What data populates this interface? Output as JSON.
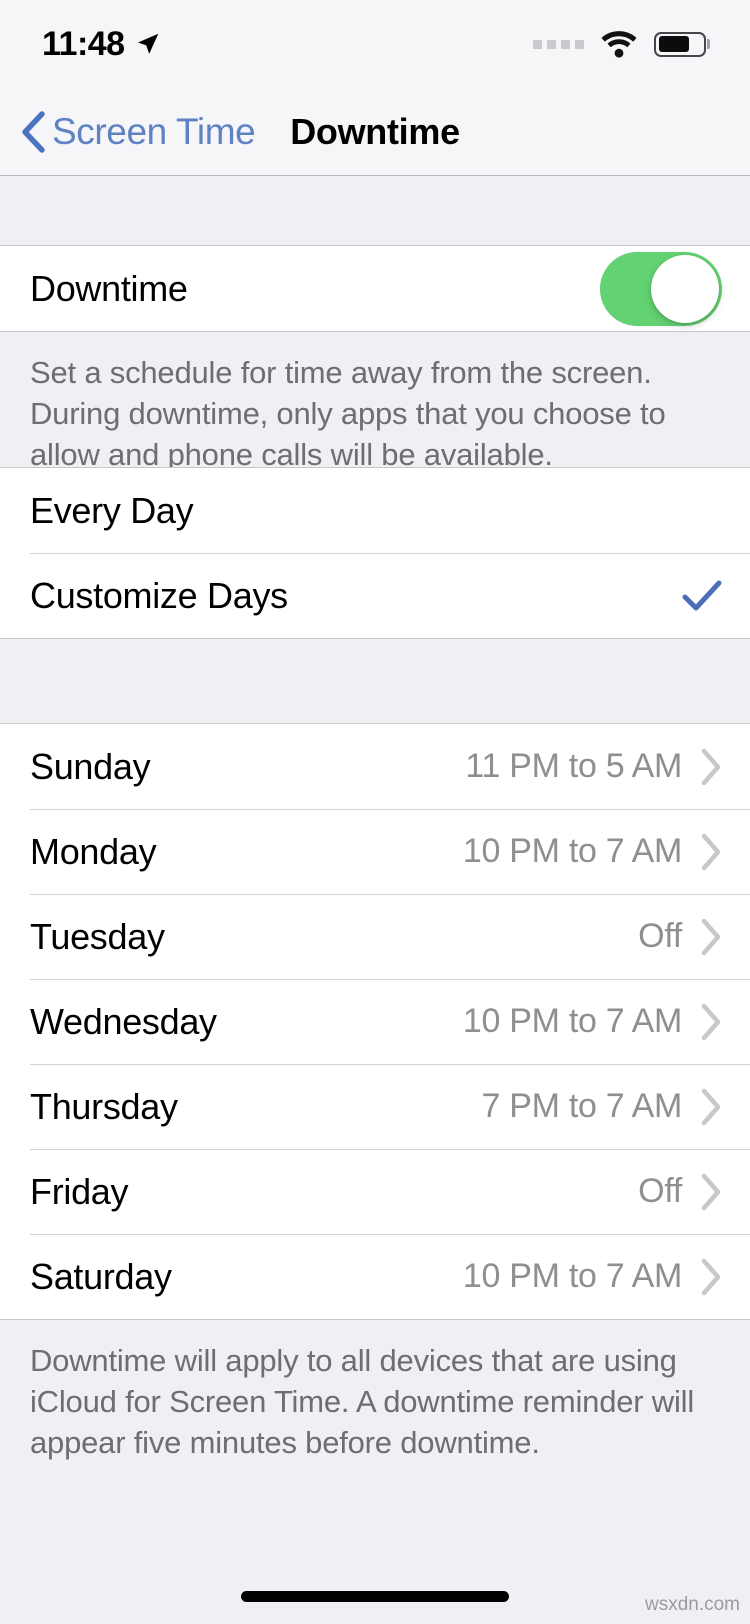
{
  "status_bar": {
    "time": "11:48",
    "location_icon": "location-arrow-icon",
    "cellular_icon": "signal-dots-icon",
    "wifi_icon": "wifi-icon",
    "battery_icon": "battery-icon",
    "battery_level_percent": 70
  },
  "nav": {
    "back_label": "Screen Time",
    "back_icon": "chevron-left-icon",
    "title": "Downtime",
    "accent_color": "#5F82C4"
  },
  "downtime_section": {
    "label": "Downtime",
    "toggle_state": "on",
    "toggle_color": "#63D272",
    "footnote": "Set a schedule for time away from the screen. During downtime, only apps that you choose to allow and phone calls will be available."
  },
  "schedule_section": {
    "options": [
      {
        "label": "Every Day",
        "selected": false
      },
      {
        "label": "Customize Days",
        "selected": true
      }
    ],
    "check_icon": "checkmark-icon",
    "check_color": "#4A6FB5"
  },
  "days_section": {
    "rows": [
      {
        "day": "Sunday",
        "value": "11 PM to 5 AM"
      },
      {
        "day": "Monday",
        "value": "10 PM to 7 AM"
      },
      {
        "day": "Tuesday",
        "value": "Off"
      },
      {
        "day": "Wednesday",
        "value": "10 PM to 7 AM"
      },
      {
        "day": "Thursday",
        "value": "7 PM to 7 AM"
      },
      {
        "day": "Friday",
        "value": "Off"
      },
      {
        "day": "Saturday",
        "value": "10 PM to 7 AM"
      }
    ],
    "disclosure_icon": "chevron-right-icon",
    "footnote": "Downtime will apply to all devices that are using iCloud for Screen Time. A downtime reminder will appear five minutes before downtime."
  },
  "home_indicator": "home-indicator",
  "watermark": "wsxdn.com"
}
